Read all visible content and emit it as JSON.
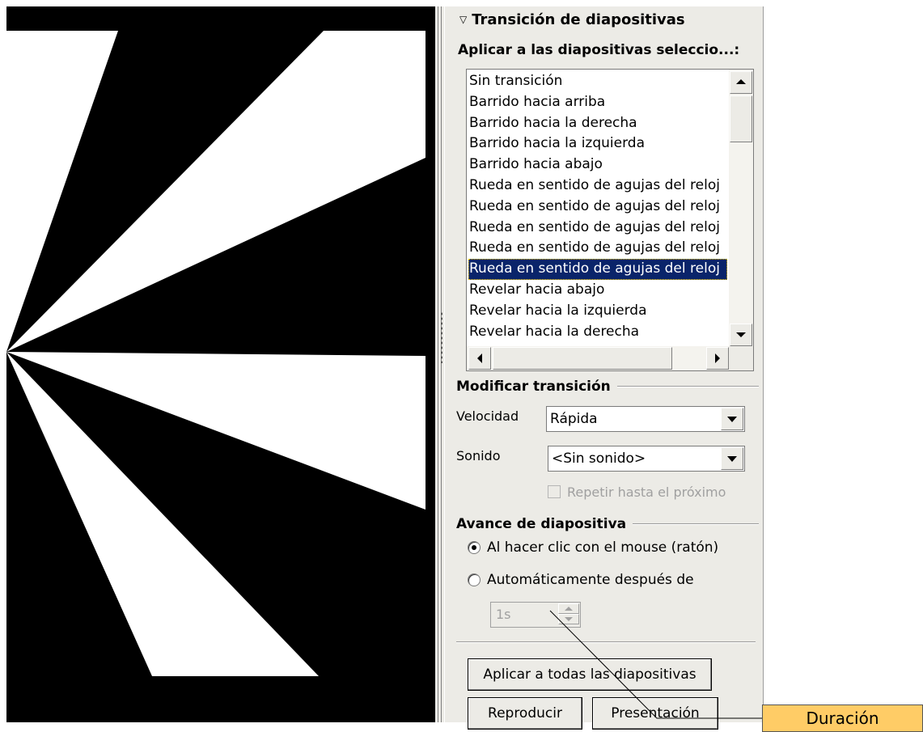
{
  "pane": {
    "title": "Transición de diapositivas",
    "apply_label": "Aplicar a las diapositivas seleccio...:",
    "transitions": [
      "Sin transición",
      "Barrido hacia arriba",
      "Barrido hacia la derecha",
      "Barrido hacia la izquierda",
      "Barrido hacia abajo",
      "Rueda en sentido de agujas del reloj",
      "Rueda en sentido de agujas del reloj",
      "Rueda en sentido de agujas del reloj",
      "Rueda en sentido de agujas del reloj",
      "Rueda en sentido de agujas del reloj",
      "Revelar hacia abajo",
      "Revelar hacia la izquierda",
      "Revelar hacia la derecha"
    ],
    "selected_transition_index": 9,
    "modify_heading": "Modificar transición",
    "speed_label": "Velocidad",
    "speed_value": "Rápida",
    "sound_label": "Sonido",
    "sound_value": "<Sin sonido>",
    "loop_label": "Repetir hasta el próximo",
    "loop_checked": false,
    "advance_heading": "Avance de diapositiva",
    "on_click_label": "Al hacer clic con el mouse (ratón)",
    "on_click_selected": true,
    "auto_label": "Automáticamente después de",
    "auto_selected": false,
    "time_value": "1s",
    "apply_all_button": "Aplicar a todas las diapositivas",
    "play_button": "Reproducir",
    "slideshow_button": "Presentación"
  },
  "callout": {
    "text": "Duración",
    "color": "#ffcc66"
  },
  "colors": {
    "pane_bg": "#ecebe6",
    "selection": "#0a246a",
    "slide_bg": "#000000",
    "slide_wedges": "#ffffff"
  }
}
